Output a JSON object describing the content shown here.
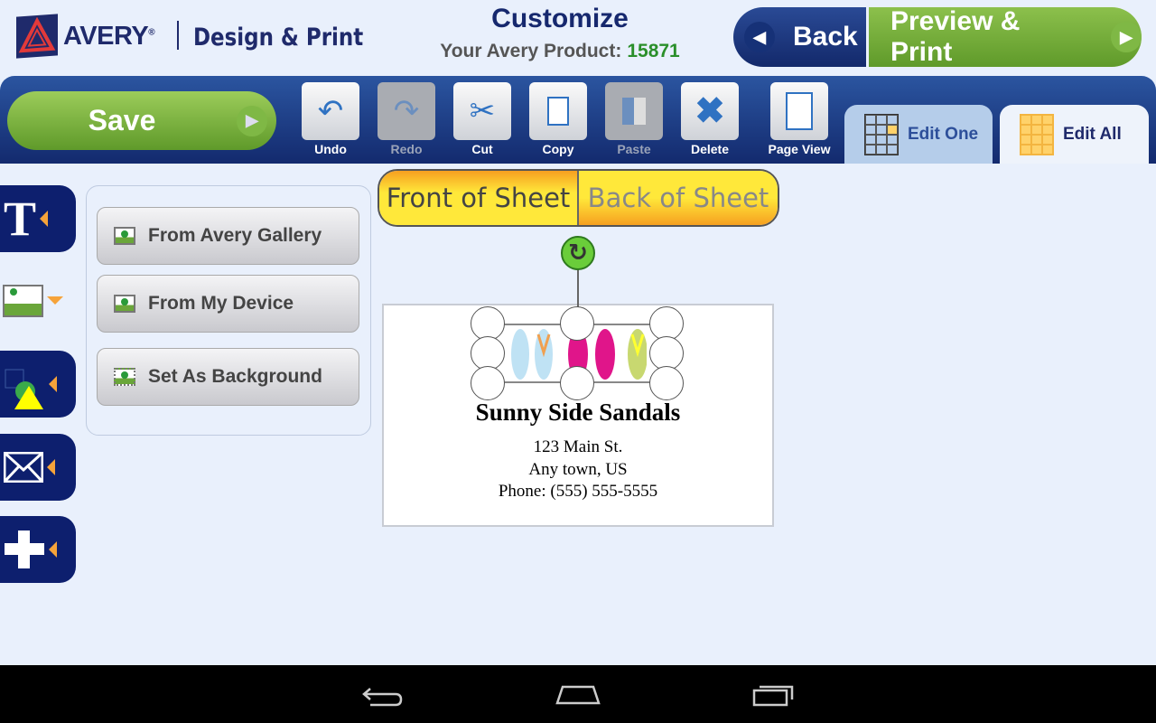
{
  "header": {
    "brand": "AVERY",
    "brand_mark": "®",
    "app_name": "Design & Print",
    "title": "Customize",
    "product_label": "Your Avery Product:",
    "product_number": "15871",
    "back_label": "Back",
    "preview_label": "Preview & Print"
  },
  "toolbar": {
    "save_label": "Save",
    "tools": [
      {
        "label": "Undo",
        "icon": "undo-icon",
        "enabled": true
      },
      {
        "label": "Redo",
        "icon": "redo-icon",
        "enabled": false
      },
      {
        "label": "Cut",
        "icon": "scissors-icon",
        "enabled": true
      },
      {
        "label": "Copy",
        "icon": "copy-icon",
        "enabled": true
      },
      {
        "label": "Paste",
        "icon": "paste-icon",
        "enabled": false
      },
      {
        "label": "Delete",
        "icon": "delete-x-icon",
        "enabled": true
      },
      {
        "label": "Page View",
        "icon": "page-icon",
        "enabled": true
      }
    ],
    "tabs": [
      {
        "label": "Edit One",
        "active": false
      },
      {
        "label": "Edit All",
        "active": true
      }
    ]
  },
  "side_tools": [
    "text-icon",
    "image-icon",
    "shapes-icon",
    "mail-merge-icon",
    "add-icon"
  ],
  "image_panel": {
    "buttons": [
      "From Avery Gallery",
      "From My Device",
      "Set As Background"
    ]
  },
  "sheet_toggle": {
    "front": "Front of Sheet",
    "back": "Back of Sheet",
    "selected": "front"
  },
  "card": {
    "title": "Sunny Side Sandals",
    "lines": [
      "123 Main St.",
      "Any town, US",
      "Phone: (555) 555-5555"
    ]
  },
  "colors": {
    "navy": "#0d1f6e",
    "green": "#6fa835",
    "accent_yellow": "#ffe83a",
    "orange": "#f6a33a"
  }
}
